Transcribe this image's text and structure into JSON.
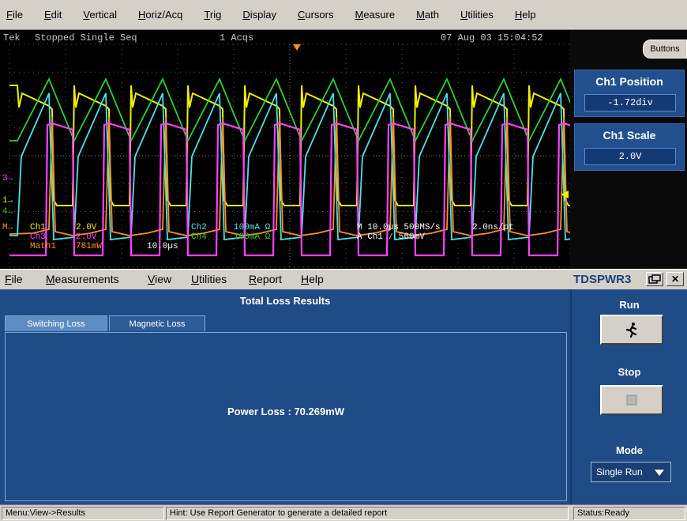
{
  "main_menu": [
    "File",
    "Edit",
    "Vertical",
    "Horiz/Acq",
    "Trig",
    "Display",
    "Cursors",
    "Measure",
    "Math",
    "Utilities",
    "Help"
  ],
  "scope": {
    "brand": "Tek",
    "acq_state": "Stopped  Single Seq",
    "acq_count": "1 Acqs",
    "datetime": "07 Aug 03 15:04:52",
    "channel_markers": [
      "3",
      "1",
      "4",
      "M"
    ],
    "readouts": {
      "ch1": "Ch1",
      "ch1_scale": "2.0V",
      "ch3": "Ch3",
      "ch3_scale": "2.0V",
      "math1": "Math1",
      "math1_scale": "781mW",
      "math1_time": "10.0µs",
      "ch2": "Ch2",
      "ch2_scale": "100mA  Ω",
      "ch4": "Ch4",
      "ch4_scale": "100mA  Ω",
      "timebase": "M 10.0µs 500MS/s",
      "resolution": "2.0ns/pt",
      "trigger": "A  Ch1  ⁄  560mV"
    },
    "colors": {
      "ch1": "#f0f000",
      "ch2": "#4fe0e8",
      "ch3": "#ff40ff",
      "ch4": "#30d030",
      "math": "#ff9020"
    }
  },
  "right_panel": {
    "buttons_label": "Buttons",
    "ch1_position_label": "Ch1 Position",
    "ch1_position_value": "-1.72div",
    "ch1_scale_label": "Ch1 Scale",
    "ch1_scale_value": "2.0V"
  },
  "app_menu": [
    "File",
    "Measurements",
    "View",
    "Utilities",
    "Report",
    "Help"
  ],
  "app_name": "TDSPWR3",
  "results": {
    "title": "Total Loss Results",
    "tabs": [
      "Switching Loss",
      "Magnetic Loss"
    ],
    "active_tab": "Switching Loss",
    "power_loss": "Power Loss : 70.269mW"
  },
  "side_panel": {
    "run_label": "Run",
    "stop_label": "Stop",
    "mode_label": "Mode",
    "mode_value": "Single Run",
    "run_icon": "running-man-icon",
    "stop_icon": "stop-square-icon"
  },
  "status_bar": {
    "menu_path": "Menu:View->Results",
    "hint": "Hint: Use Report Generator to generate a detailed report",
    "status": "Status:Ready"
  }
}
